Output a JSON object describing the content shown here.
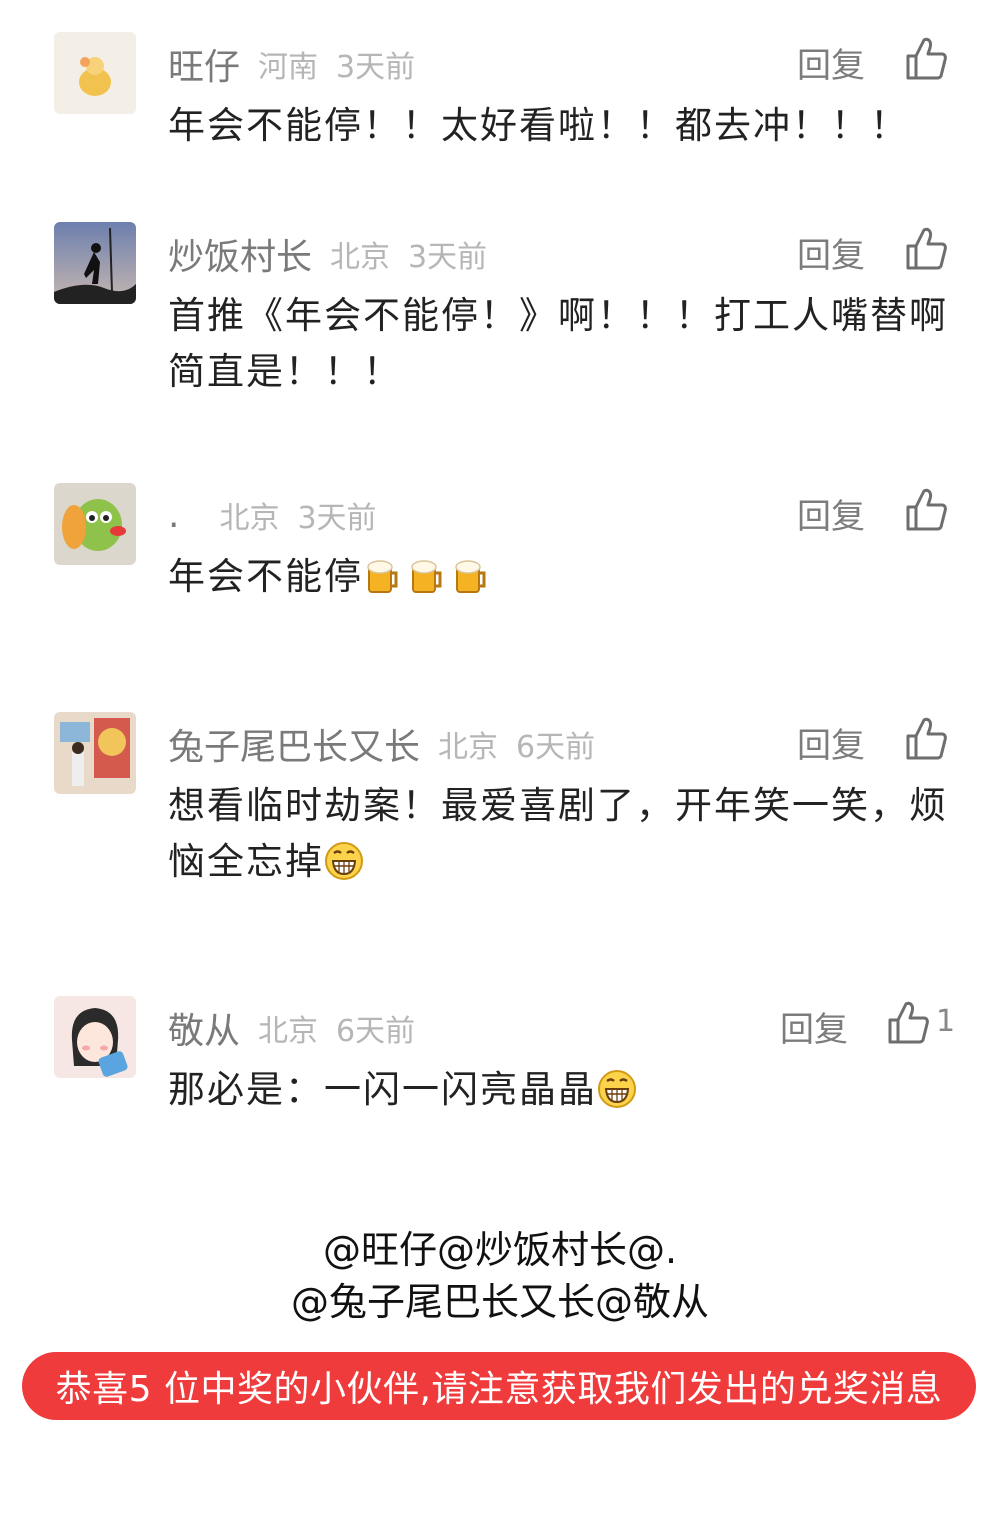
{
  "comments": [
    {
      "username": "旺仔",
      "location": "河南",
      "time": "3天前",
      "reply_label": "回复",
      "like_count": "",
      "text": "年会不能停！！太好看啦！！都去冲！！！",
      "text_emojis": []
    },
    {
      "username": "炒饭村长",
      "location": "北京",
      "time": "3天前",
      "reply_label": "回复",
      "like_count": "",
      "text": "首推《年会不能停！》啊！！！打工人嘴替啊简直是！！！",
      "text_emojis": []
    },
    {
      "username": ".",
      "location": "北京",
      "time": "3天前",
      "reply_label": "回复",
      "like_count": "",
      "text": "年会不能停",
      "text_emojis": [
        "beer-icon",
        "beer-icon",
        "beer-icon"
      ]
    },
    {
      "username": "兔子尾巴长又长",
      "location": "北京",
      "time": "6天前",
      "reply_label": "回复",
      "like_count": "",
      "text": "想看临时劫案！最爱喜剧了，开年笑一笑，烦恼全忘掉",
      "text_emojis": [
        "grin-icon"
      ]
    },
    {
      "username": "敬从",
      "location": "北京",
      "time": "6天前",
      "reply_label": "回复",
      "like_count": "1",
      "text": "那必是：一闪一闪亮晶晶",
      "text_emojis": [
        "grin-icon"
      ]
    }
  ],
  "winners": {
    "line1": "@旺仔@炒饭村长@.",
    "line2": "@兔子尾巴长又长@敬从"
  },
  "banner": {
    "text": "恭喜5 位中奖的小伙伴,请注意获取我们发出的兑奖消息"
  },
  "colors": {
    "banner_bg": "#ef3b3b",
    "username": "#7a7a7a",
    "meta": "#b6b6b6",
    "body_text": "#222222"
  }
}
